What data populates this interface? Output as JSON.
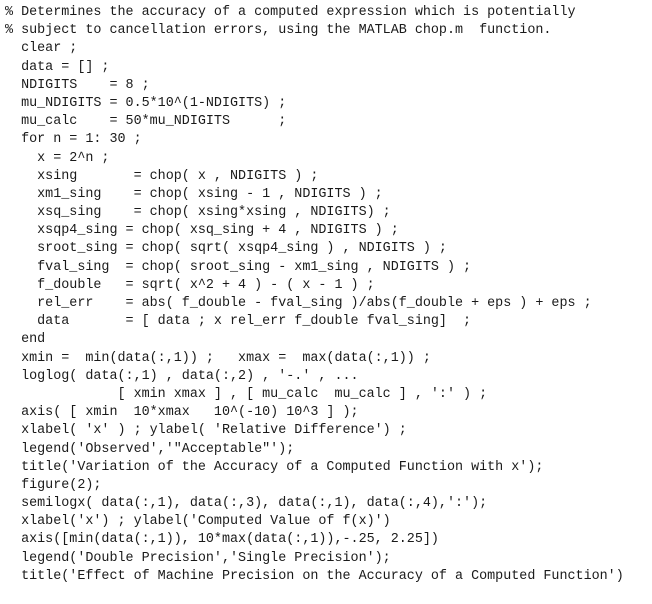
{
  "document": {
    "type": "matlab-code-listing",
    "lines": [
      "% Determines the accuracy of a computed expression which is potentially",
      "% subject to cancellation errors, using the MATLAB chop.m  function.",
      "  clear ;",
      "  data = [] ;",
      "  NDIGITS    = 8 ;",
      "  mu_NDIGITS = 0.5*10^(1-NDIGITS) ;",
      "  mu_calc    = 50*mu_NDIGITS      ;",
      "  for n = 1: 30 ;",
      "    x = 2^n ;",
      "    xsing       = chop( x , NDIGITS ) ;",
      "    xm1_sing    = chop( xsing - 1 , NDIGITS ) ;",
      "    xsq_sing    = chop( xsing*xsing , NDIGITS) ;",
      "    xsqp4_sing = chop( xsq_sing + 4 , NDIGITS ) ;",
      "    sroot_sing = chop( sqrt( xsqp4_sing ) , NDIGITS ) ;",
      "    fval_sing  = chop( sroot_sing - xm1_sing , NDIGITS ) ;",
      "    f_double   = sqrt( x^2 + 4 ) - ( x - 1 ) ;",
      "    rel_err    = abs( f_double - fval_sing )/abs(f_double + eps ) + eps ;",
      "    data       = [ data ; x rel_err f_double fval_sing]  ;",
      "  end",
      "  xmin =  min(data(:,1)) ;   xmax =  max(data(:,1)) ;",
      "  loglog( data(:,1) , data(:,2) , '-.' , ...",
      "              [ xmin xmax ] , [ mu_calc  mu_calc ] , ':' ) ;",
      "  axis( [ xmin  10*xmax   10^(-10) 10^3 ] );",
      "  xlabel( 'x' ) ; ylabel( 'Relative Difference') ;",
      "  legend('Observed','\"Acceptable\"');",
      "  title('Variation of the Accuracy of a Computed Function with x');",
      "  figure(2);",
      "  semilogx( data(:,1), data(:,3), data(:,1), data(:,4),':');",
      "  xlabel('x') ; ylabel('Computed Value of f(x)')",
      "  axis([min(data(:,1)), 10*max(data(:,1)),-.25, 2.25])",
      "  legend('Double Precision','Single Precision');",
      "  title('Effect of Machine Precision on the Accuracy of a Computed Function')"
    ]
  }
}
